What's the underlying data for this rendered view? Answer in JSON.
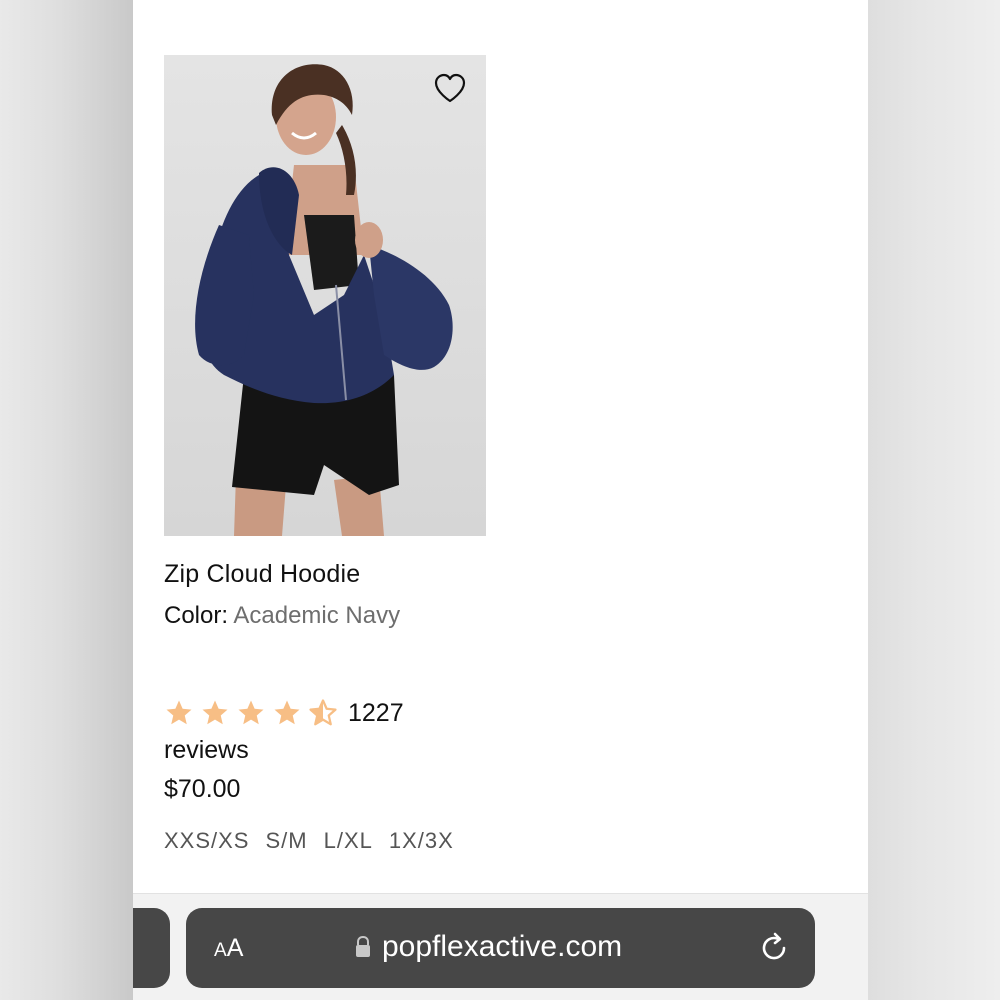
{
  "product": {
    "name": "Zip Cloud Hoodie",
    "color_label": "Color:",
    "color_value": "Academic Navy",
    "rating": 4.5,
    "rating_max": 5,
    "review_count": "1227",
    "reviews_label": "reviews",
    "price": "$70.00",
    "sizes": [
      "XXS/XS",
      "S/M",
      "L/XL",
      "1X/3X"
    ],
    "wishlist_icon": "heart-outline-icon",
    "star_color": "#F7BE85"
  },
  "browser": {
    "text_size_label_small": "A",
    "text_size_label_large": "A",
    "url": "popflexactive.com",
    "lock_icon": "lock-icon",
    "reload_icon": "reload-icon"
  }
}
